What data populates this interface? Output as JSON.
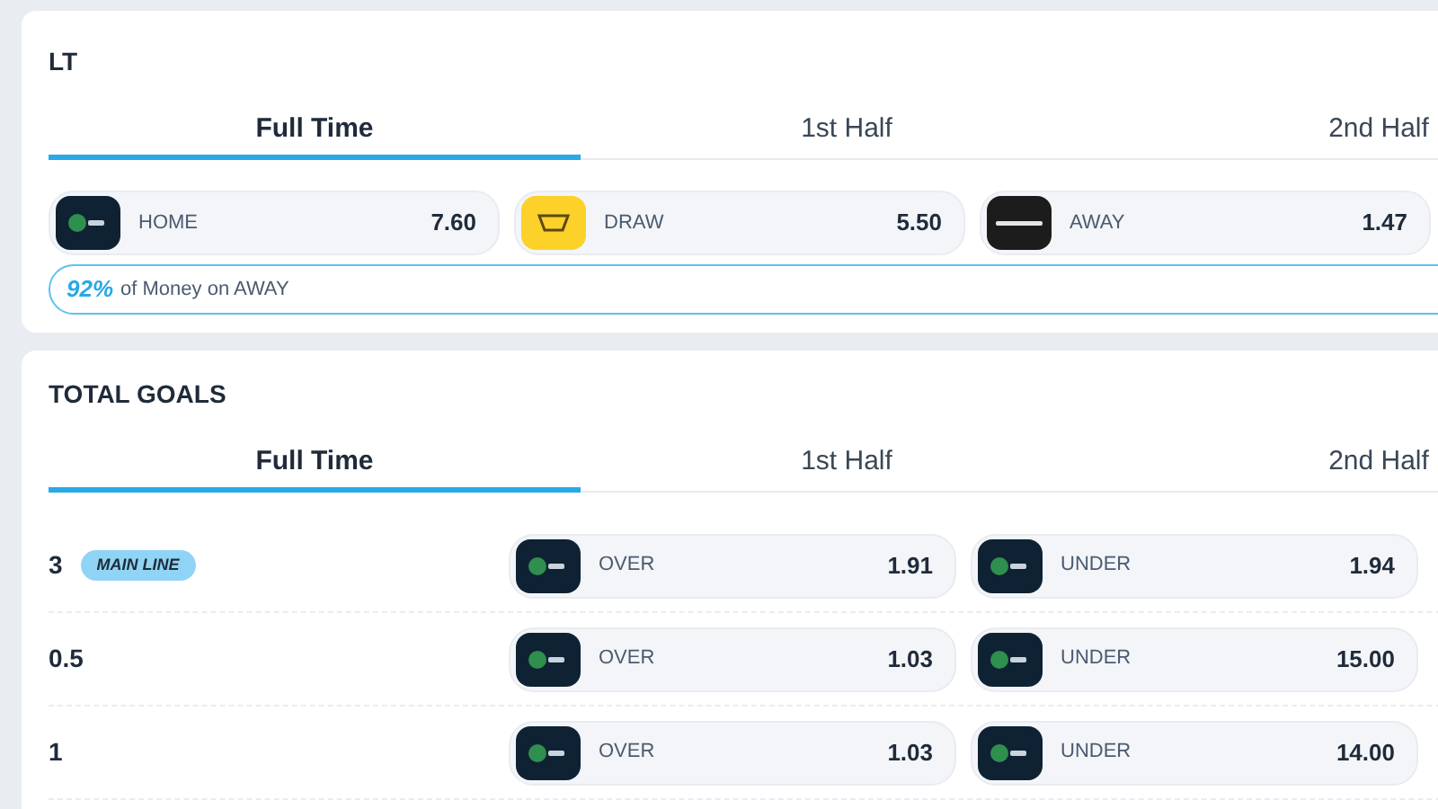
{
  "match_result": {
    "title": "LT",
    "tabs": [
      {
        "label": "Full Time",
        "selected": true
      },
      {
        "label": "1st Half",
        "selected": false
      },
      {
        "label": "2nd Half",
        "selected": false
      }
    ],
    "outcomes": [
      {
        "kind": "twenty",
        "label": "HOME",
        "odds": "7.60"
      },
      {
        "kind": "yellow",
        "label": "DRAW",
        "odds": "5.50"
      },
      {
        "kind": "mega",
        "label": "AWAY",
        "odds": "1.47"
      }
    ],
    "money_note": {
      "percent": "92%",
      "text": "of Money on AWAY"
    }
  },
  "total_goals": {
    "title": "TOTAL GOALS",
    "tabs": [
      {
        "label": "Full Time",
        "selected": true
      },
      {
        "label": "1st Half",
        "selected": false
      },
      {
        "label": "2nd Half",
        "selected": false
      }
    ],
    "rows": [
      {
        "line": "3",
        "badge": "MAIN LINE",
        "over": {
          "kind": "twenty",
          "label": "OVER",
          "odds": "1.91"
        },
        "under": {
          "kind": "twenty",
          "label": "UNDER",
          "odds": "1.94"
        }
      },
      {
        "line": "0.5",
        "over": {
          "kind": "twenty",
          "label": "OVER",
          "odds": "1.03"
        },
        "under": {
          "kind": "twenty",
          "label": "UNDER",
          "odds": "15.00"
        }
      },
      {
        "line": "1",
        "over": {
          "kind": "twenty",
          "label": "OVER",
          "odds": "1.03"
        },
        "under": {
          "kind": "twenty",
          "label": "UNDER",
          "odds": "14.00"
        }
      }
    ]
  }
}
